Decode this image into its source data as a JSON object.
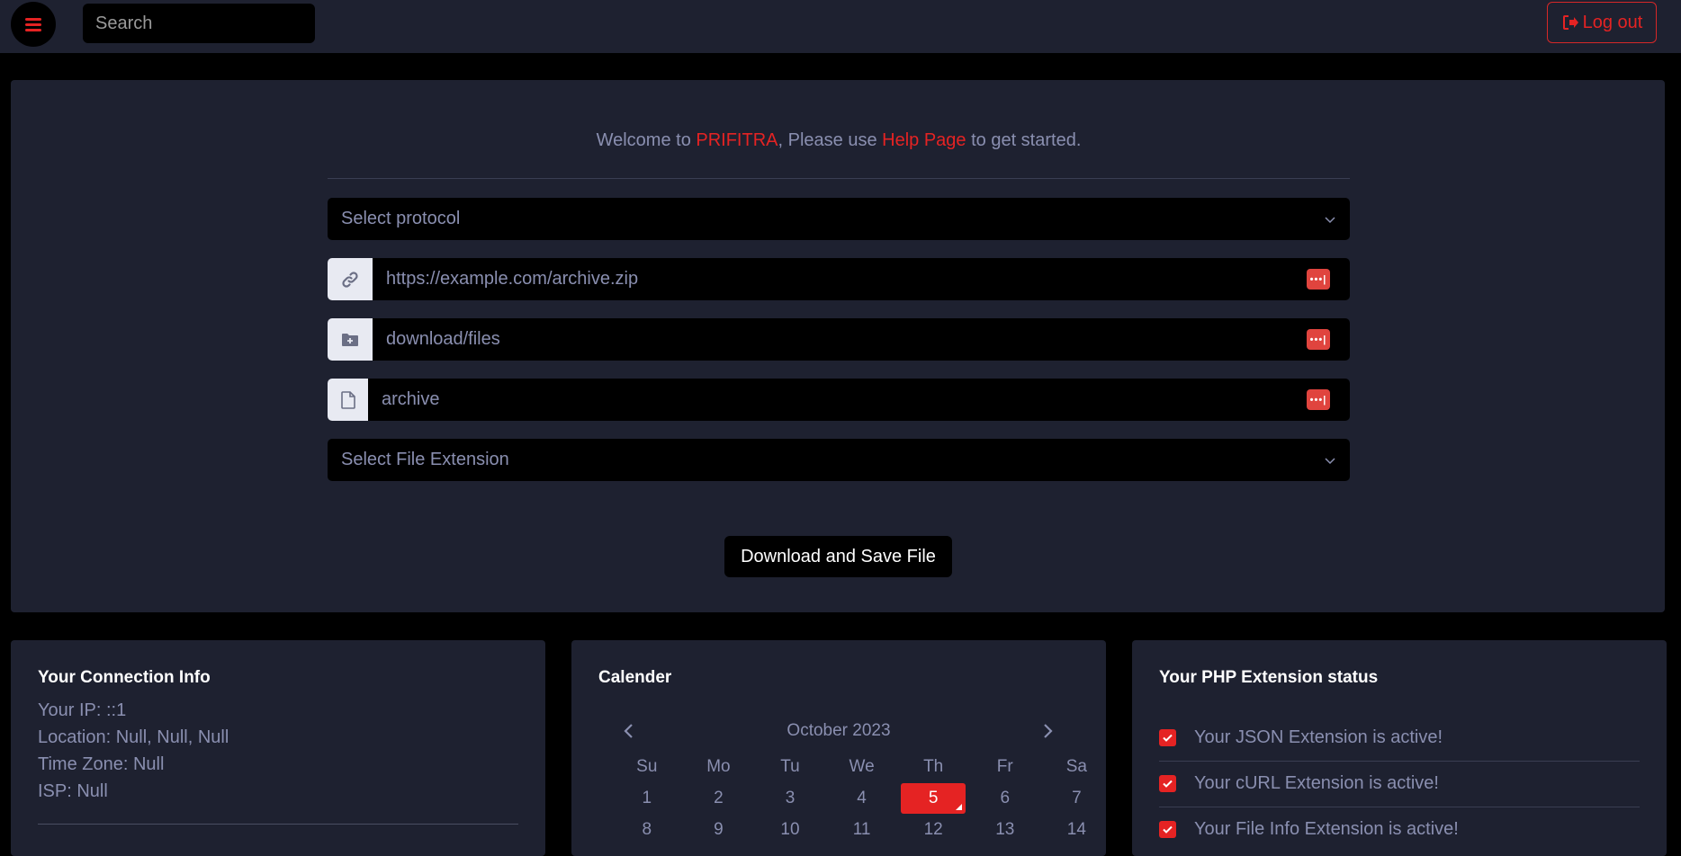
{
  "topbar": {
    "search_placeholder": "Search",
    "logout_label": "Log out"
  },
  "welcome": {
    "prefix": "Welcome to ",
    "brand": "PRIFITRA",
    "middle": ", Please use ",
    "help_link": "Help Page",
    "suffix": " to get started."
  },
  "form": {
    "protocol_select": "Select protocol",
    "url_placeholder": "https://example.com/archive.zip",
    "folder_placeholder": "download/files",
    "filename_placeholder": "archive",
    "extension_select": "Select File Extension",
    "submit_label": "Download and Save File"
  },
  "connection": {
    "title": "Your Connection Info",
    "lines": [
      "Your IP: ::1",
      "Location: Null, Null, Null",
      "Time Zone: Null",
      "ISP: Null"
    ]
  },
  "calendar": {
    "title": "Calender",
    "month": "October 2023",
    "weekdays": [
      "Su",
      "Mo",
      "Tu",
      "We",
      "Th",
      "Fr",
      "Sa"
    ],
    "weeks": [
      [
        "1",
        "2",
        "3",
        "4",
        "5",
        "6",
        "7"
      ],
      [
        "8",
        "9",
        "10",
        "11",
        "12",
        "13",
        "14"
      ]
    ],
    "today": "5"
  },
  "php": {
    "title": "Your PHP Extension status",
    "items": [
      "Your JSON Extension is active!",
      "Your cURL Extension is active!",
      "Your File Info Extension is active!"
    ]
  },
  "colors": {
    "accent": "#e52323",
    "panel": "#1e2130",
    "background": "#000000"
  },
  "icons": [
    "hamburger-menu-icon",
    "logout-icon",
    "link-icon",
    "folder-plus-icon",
    "file-icon",
    "password-dots-icon",
    "chevron-down-icon",
    "chevron-left-icon",
    "chevron-right-icon",
    "check-icon"
  ]
}
